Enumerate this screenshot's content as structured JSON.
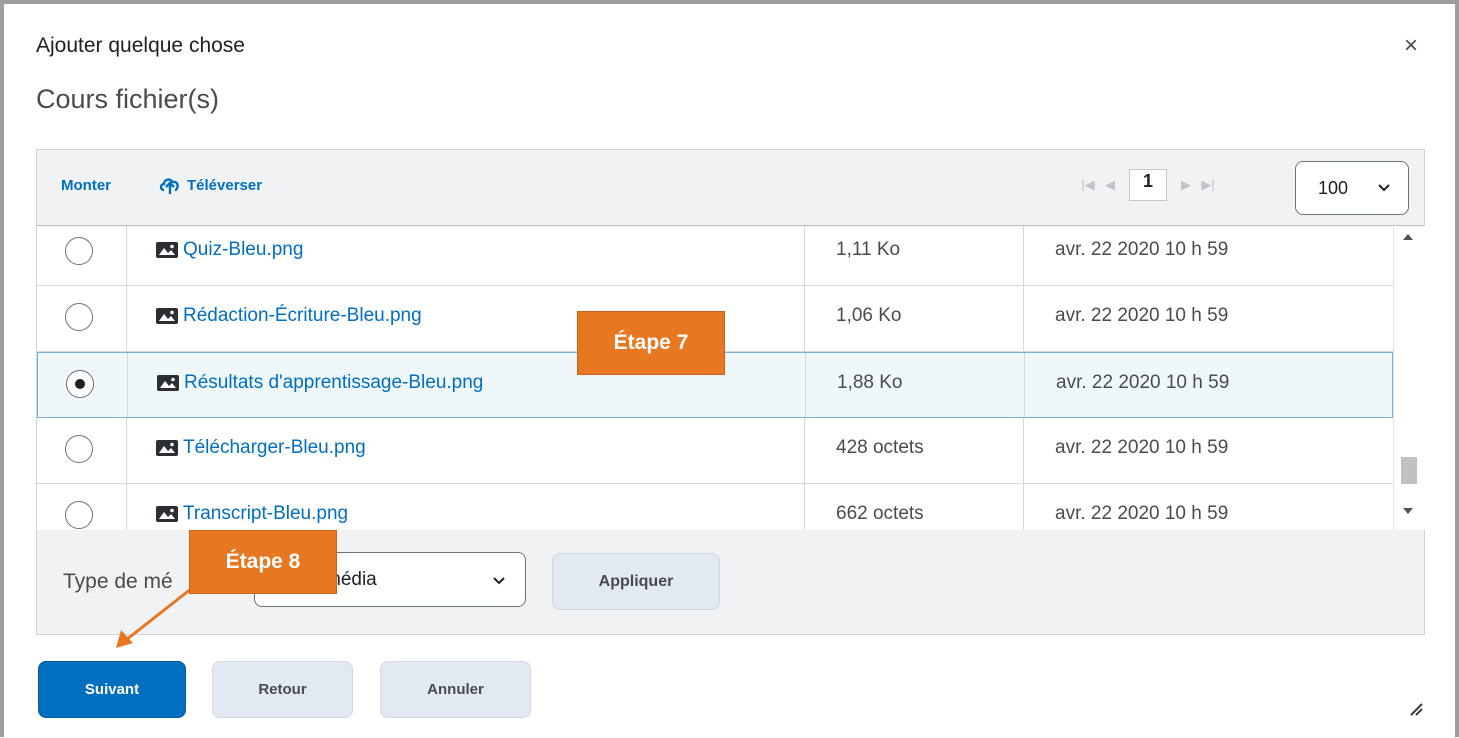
{
  "dialog": {
    "title": "Ajouter quelque chose",
    "subtitle": "Cours fichier(s)",
    "close_label": "×"
  },
  "toolbar": {
    "up_label": "Monter",
    "upload_label": "Téléverser",
    "page_first": "⏮",
    "page_prev": "◀",
    "page_current": "1",
    "page_next": "▶",
    "page_last": "⏭",
    "page_size": "100"
  },
  "files": [
    {
      "name": "Quiz-Bleu.png",
      "size": "1,11 Ko",
      "date": "avr. 22 2020 10 h 59",
      "selected": false
    },
    {
      "name": "Rédaction-Écriture-Bleu.png",
      "size": "1,06 Ko",
      "date": "avr. 22 2020 10 h 59",
      "selected": false
    },
    {
      "name": "Résultats d'apprentissage-Bleu.png",
      "size": "1,88 Ko",
      "date": "avr. 22 2020 10 h 59",
      "selected": true
    },
    {
      "name": "Télécharger-Bleu.png",
      "size": "428 octets",
      "date": "avr. 22 2020 10 h 59",
      "selected": false
    },
    {
      "name": "Transcript-Bleu.png",
      "size": "662 octets",
      "date": "avr. 22 2020 10 h 59",
      "selected": false
    }
  ],
  "filter": {
    "label": "Type de mé",
    "select_value": "média",
    "apply_label": "Appliquer"
  },
  "footer": {
    "next_label": "Suivant",
    "back_label": "Retour",
    "cancel_label": "Annuler"
  },
  "callouts": {
    "step7": "Étape 7",
    "step8": "Étape 8"
  },
  "colors": {
    "accent": "#006fbf",
    "callout": "#e87722",
    "selected_row": "#f0f7fb"
  }
}
